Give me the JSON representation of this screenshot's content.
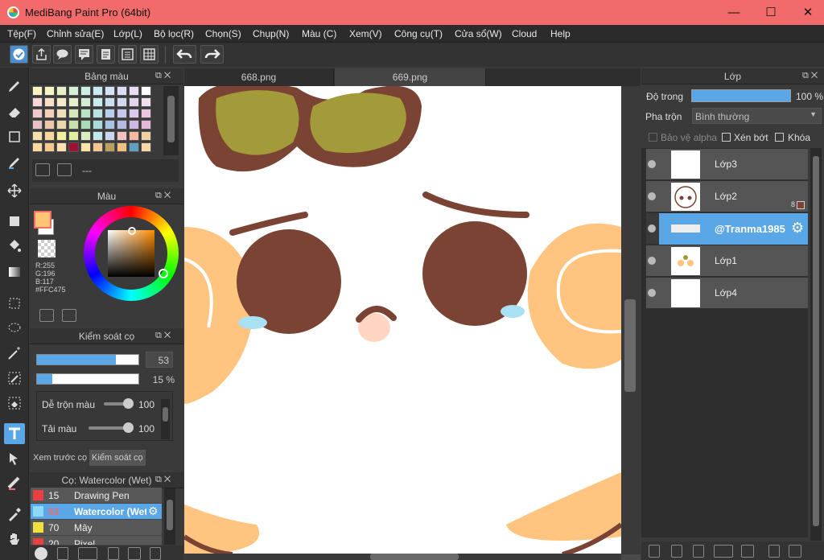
{
  "window": {
    "title": "MediBang Paint Pro (64bit)",
    "minimize": "—",
    "maximize": "☐",
    "close": "✕"
  },
  "menu": [
    "Tệp(F)",
    "Chỉnh sửa(E)",
    "Lớp(L)",
    "Bộ lọc(R)",
    "Chọn(S)",
    "Chụp(N)",
    "Màu (C)",
    "Xem(V)",
    "Công cụ(T)",
    "Cửa sổ(W)",
    "Cloud",
    "Help"
  ],
  "palette": {
    "title": "Bảng màu",
    "name_placeholder": "---",
    "colors": [
      "#fff3c0",
      "#f3f8c0",
      "#e6f3c8",
      "#d6f0d6",
      "#cdeee6",
      "#cbe9f3",
      "#d3e3f6",
      "#dcdcf6",
      "#eadcf4",
      "#ffffff",
      "#f6d8d8",
      "#f8e0c8",
      "#f4ecc8",
      "#e6f0c8",
      "#d4ecd4",
      "#c8ecec",
      "#c8e0f0",
      "#d4d8f0",
      "#e4d4ee",
      "#f0e0f0",
      "#f0c8d0",
      "#f2d0b8",
      "#eee0b8",
      "#d4e8b8",
      "#b8e4c8",
      "#b8e4e4",
      "#b8d0ec",
      "#c8c8ec",
      "#dcc8ec",
      "#ecc8e0",
      "#e8c0c8",
      "#f0c8a8",
      "#e8d8a8",
      "#c8e0a8",
      "#a8dcb8",
      "#a8dcdc",
      "#a8c4e4",
      "#b8b8e4",
      "#d0b8e4",
      "#e4b8d8",
      "#f4e0a8",
      "#f8d898",
      "#f0f0a0",
      "#e0f0a0",
      "#d8f0c0",
      "#c0e8f0",
      "#c8d8f0",
      "#f4c0c0",
      "#f8b8a0",
      "#f0d0a0",
      "#ffd8a0",
      "#f8c88c",
      "#ffe0b0",
      "#a01030",
      "#ffe4a8",
      "#f4c890",
      "#b8a060",
      "#f0c080",
      "#60a0c0",
      "#f8d8a8"
    ]
  },
  "color_panel": {
    "title": "Màu",
    "primary": "#FFC475",
    "r": "R:255",
    "g": "G:196",
    "b": "B:117",
    "hex": "#FFC475"
  },
  "brush_control": {
    "title": "Kiểm soát cọ",
    "size_value": "53",
    "size_fill": 0.78,
    "opacity_value": "15 %",
    "opacity_fill": 0.15,
    "blend_label": "Dễ trộn màu",
    "blend_value": "100",
    "load_label": "Tải màu",
    "load_value": "100",
    "tab_preview": "Xem trước cọ",
    "tab_control": "Kiểm soát cọ"
  },
  "brush_list": {
    "title": "Cọ: Watercolor (Wet)",
    "items": [
      {
        "num": "15",
        "name": "Drawing Pen",
        "color": "#e84040"
      },
      {
        "num": "53",
        "name": "Watercolor (Wet)",
        "color": "#90d8f8"
      },
      {
        "num": "70",
        "name": "Mây",
        "color": "#f0e040"
      },
      {
        "num": "20",
        "name": "Pixel",
        "color": "#e84040"
      }
    ]
  },
  "tabs": [
    "668.png",
    "669.png"
  ],
  "layers_panel": {
    "title": "Lớp",
    "opacity_label": "Độ trong",
    "opacity_value": "100 %",
    "blend_label": "Pha trộn",
    "blend_mode": "Bình thường",
    "protect_alpha": "Bảo vệ alpha",
    "clip": "Xén bớt",
    "lock": "Khóa",
    "layers": [
      {
        "name": "Lớp3",
        "selected": false,
        "thumb": "checker"
      },
      {
        "name": "Lớp2",
        "selected": false,
        "thumb": "face",
        "badge": "8"
      },
      {
        "name": "@Tranma1985",
        "selected": true,
        "thumb": "text"
      },
      {
        "name": "Lớp1",
        "selected": false,
        "thumb": "sketch"
      },
      {
        "name": "Lớp4",
        "selected": false,
        "thumb": "white"
      }
    ]
  },
  "artwork_colors": {
    "brown": "#7a4333",
    "olive": "#a39a3a",
    "peach": "#ffc47f",
    "tear": "#a8e0f4",
    "accent": "#5aa7e8"
  }
}
